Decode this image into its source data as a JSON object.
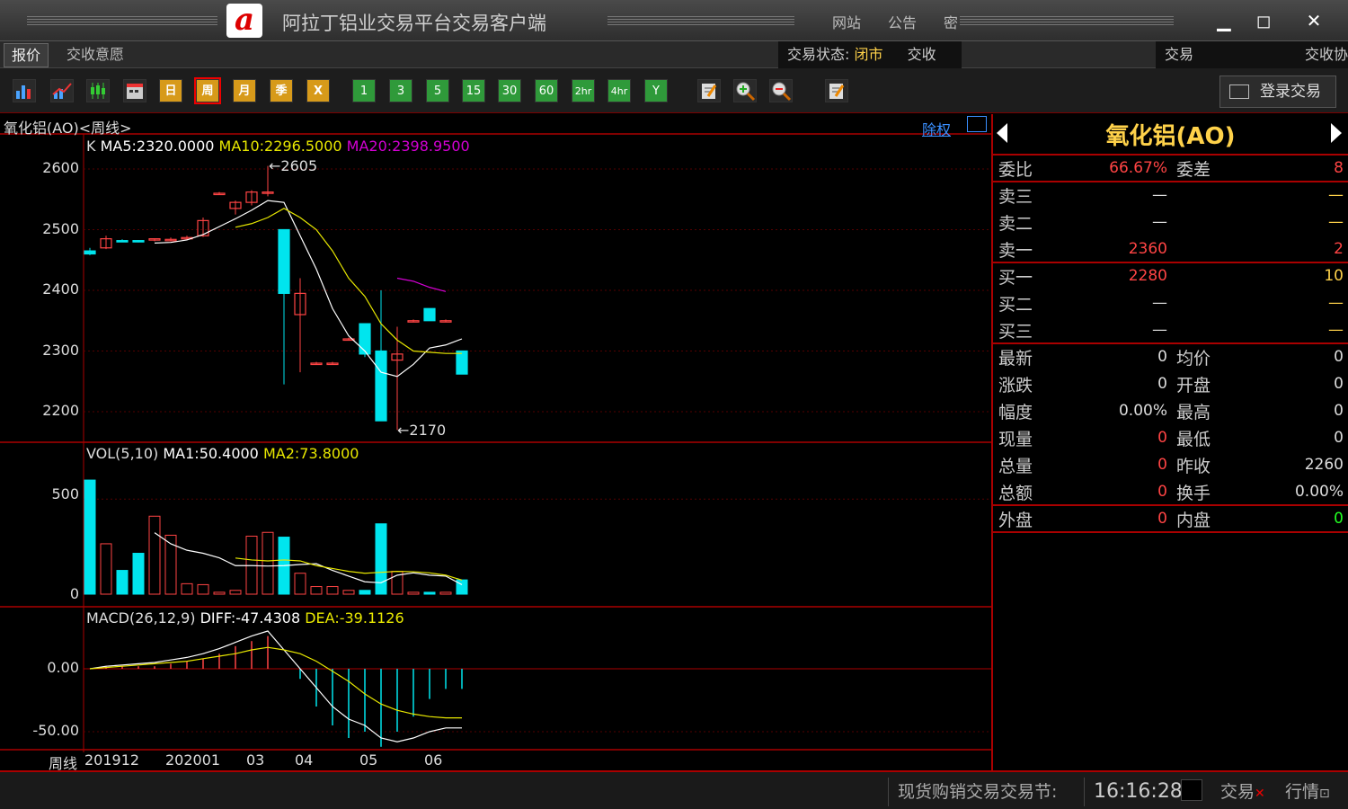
{
  "window": {
    "title": "阿拉丁铝业交易平台交易客户端",
    "links": [
      "网站",
      "公告",
      "密"
    ],
    "logo": "a"
  },
  "tabs": [
    "报价",
    "交收意愿"
  ],
  "status": {
    "label": "交易状态:",
    "value": "闭市",
    "extra": "交收",
    "right1": "交易",
    "right2": "交收协"
  },
  "toolbar": {
    "periods": [
      "日",
      "周",
      "月",
      "季",
      "X"
    ],
    "minutes": [
      "1",
      "3",
      "5",
      "15",
      "30",
      "60",
      "2hr",
      "4hr",
      "Y"
    ],
    "login": "登录交易"
  },
  "chart_header": {
    "name": "氧化铝(AO)<周线>",
    "fuquan": "除权"
  },
  "kline_legend": {
    "k": "K",
    "ma5": "MA5:2320.0000",
    "ma10": "MA10:2296.5000",
    "ma20": "MA20:2398.9500"
  },
  "vol_legend": {
    "vol": "VOL(5,10)",
    "ma1": "MA1:50.4000",
    "ma2": "MA2:73.8000"
  },
  "macd_legend": {
    "macd": "MACD(26,12,9)",
    "diff": "DIFF:-47.4308",
    "dea": "DEA:-39.1126"
  },
  "price_ticks": [
    "2600",
    "2500",
    "2400",
    "2300",
    "2200"
  ],
  "vol_ticks": [
    "500",
    "0"
  ],
  "macd_ticks": [
    "0.00",
    "-50.00"
  ],
  "x_ticks": {
    "prefix": "周线",
    "labels": [
      "201912",
      "202001",
      "03",
      "04",
      "05",
      "06"
    ]
  },
  "annotations": {
    "high": "2605",
    "low": "2170"
  },
  "colors": {
    "up": "#ff4444",
    "down": "#00e5ee",
    "ma5": "#ffffff",
    "ma10": "#e8e800",
    "ma20": "#d400d4",
    "border": "#aa0000"
  },
  "chart_data": {
    "type": "candlestick",
    "ohlc": [
      [
        2465,
        2470,
        2458,
        2460
      ],
      [
        2470,
        2490,
        2468,
        2485
      ],
      [
        2482,
        2484,
        2480,
        2481
      ],
      [
        2482,
        2483,
        2479,
        2480
      ],
      [
        2483,
        2486,
        2481,
        2485
      ],
      [
        2482,
        2487,
        2481,
        2484
      ],
      [
        2485,
        2490,
        2483,
        2487
      ],
      [
        2490,
        2520,
        2488,
        2515
      ],
      [
        2560,
        2562,
        2558,
        2560
      ],
      [
        2535,
        2548,
        2525,
        2545
      ],
      [
        2545,
        2565,
        2540,
        2562
      ],
      [
        2560,
        2605,
        2555,
        2562
      ],
      [
        2500,
        2500,
        2245,
        2395
      ],
      [
        2360,
        2420,
        2265,
        2395
      ],
      [
        2280,
        2282,
        2278,
        2280
      ],
      [
        2280,
        2282,
        2278,
        2280
      ],
      [
        2320,
        2322,
        2318,
        2320
      ],
      [
        2345,
        2345,
        2290,
        2295
      ],
      [
        2300,
        2400,
        2185,
        2185
      ],
      [
        2285,
        2340,
        2170,
        2295
      ],
      [
        2350,
        2352,
        2348,
        2350
      ],
      [
        2370,
        2370,
        2350,
        2350
      ],
      [
        2350,
        2352,
        2348,
        2350
      ],
      [
        2300,
        2300,
        2262,
        2262
      ]
    ],
    "ma5": [
      null,
      null,
      null,
      null,
      2478,
      2479,
      2483,
      2492,
      2505,
      2518,
      2532,
      2548,
      2545,
      2490,
      2435,
      2370,
      2325,
      2300,
      2265,
      2258,
      2278,
      2305,
      2310,
      2320
    ],
    "ma10": [
      null,
      null,
      null,
      null,
      null,
      null,
      null,
      null,
      null,
      2504,
      2510,
      2520,
      2535,
      2520,
      2500,
      2465,
      2420,
      2390,
      2345,
      2318,
      2300,
      2298,
      2296,
      2296
    ],
    "ma20": [
      null,
      null,
      null,
      null,
      null,
      null,
      null,
      null,
      null,
      null,
      null,
      null,
      null,
      null,
      null,
      null,
      null,
      null,
      null,
      2420,
      2415,
      2405,
      2398
    ],
    "ylim": [
      2160,
      2620
    ],
    "volume": [
      600,
      265,
      125,
      215,
      410,
      310,
      55,
      50,
      10,
      20,
      305,
      325,
      300,
      110,
      40,
      40,
      20,
      20,
      370,
      120,
      10,
      10,
      10,
      75
    ],
    "vol_ma1": [
      null,
      null,
      null,
      null,
      323,
      265,
      231,
      215,
      191,
      150,
      150,
      148,
      150,
      156,
      160,
      125,
      95,
      65,
      60,
      100,
      112,
      100,
      95,
      50
    ],
    "vol_ma2": [
      null,
      null,
      null,
      null,
      null,
      null,
      null,
      null,
      null,
      190,
      180,
      175,
      180,
      175,
      150,
      135,
      120,
      110,
      115,
      120,
      118,
      112,
      100,
      74
    ],
    "vol_ylim": [
      0,
      620
    ],
    "macd_diff": [
      0,
      2,
      3,
      4,
      5,
      7,
      9,
      12,
      16,
      21,
      26,
      30,
      15,
      0,
      -15,
      -30,
      -40,
      -45,
      -55,
      -58,
      -55,
      -50,
      -47,
      -47
    ],
    "macd_dea": [
      0,
      1,
      2,
      3,
      4,
      5,
      6,
      8,
      10,
      12,
      15,
      17,
      15,
      12,
      6,
      -2,
      -10,
      -20,
      -28,
      -33,
      -36,
      -38,
      -39,
      -39
    ],
    "macd_hist": [
      0,
      2,
      2,
      2,
      2,
      4,
      6,
      8,
      12,
      18,
      22,
      26,
      0,
      -8,
      -30,
      -45,
      -55,
      -50,
      -62,
      -50,
      -38,
      -24,
      -16,
      -16
    ],
    "macd_ylim": [
      -65,
      28
    ]
  },
  "quote": {
    "symbol": "氧化铝(AO)",
    "rows": [
      {
        "l1": "委比",
        "v1": "66.67%",
        "l2": "委差",
        "v2": "8"
      },
      {
        "l1": "卖三",
        "v1": "—",
        "l2": "",
        "v2": "—"
      },
      {
        "l1": "卖二",
        "v1": "—",
        "l2": "",
        "v2": "—"
      },
      {
        "l1": "卖一",
        "v1": "2360",
        "l2": "",
        "v2": "2"
      },
      {
        "l1": "买一",
        "v1": "2280",
        "l2": "",
        "v2": "10"
      },
      {
        "l1": "买二",
        "v1": "—",
        "l2": "",
        "v2": "—"
      },
      {
        "l1": "买三",
        "v1": "—",
        "l2": "",
        "v2": "—"
      },
      {
        "l1": "最新",
        "v1": "0",
        "l2": "均价",
        "v2": "0"
      },
      {
        "l1": "涨跌",
        "v1": "0",
        "l2": "开盘",
        "v2": "0"
      },
      {
        "l1": "幅度",
        "v1": "0.00%",
        "l2": "最高",
        "v2": "0"
      },
      {
        "l1": "现量",
        "v1": "0",
        "l2": "最低",
        "v2": "0"
      },
      {
        "l1": "总量",
        "v1": "0",
        "l2": "昨收",
        "v2": "2260"
      },
      {
        "l1": "总额",
        "v1": "0",
        "l2": "换手",
        "v2": "0.00%"
      },
      {
        "l1": "外盘",
        "v1": "0",
        "l2": "内盘",
        "v2": "0"
      }
    ]
  },
  "statusbar": {
    "festival": "现货购销交易交易节:",
    "time": "16:16:28",
    "trade": "交易",
    "market": "行情"
  }
}
